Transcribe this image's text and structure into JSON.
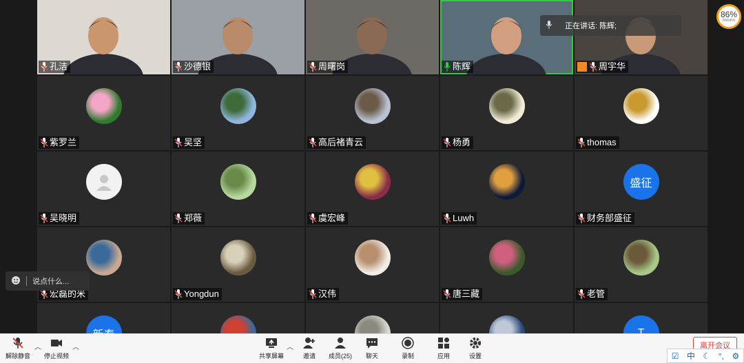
{
  "speaker": {
    "label": "正在讲话:",
    "name": "陈辉;"
  },
  "badge": {
    "percent": "86%",
    "sub": "PAKIKN"
  },
  "participants": [
    {
      "name": "孔洁",
      "kind": "video",
      "skin": "#c9966e",
      "bg": "#ddd8d2"
    },
    {
      "name": "沙德银",
      "kind": "video",
      "skin": "#b98b6a",
      "bg": "#9aa0a6"
    },
    {
      "name": "周曙岗",
      "kind": "video",
      "skin": "#8a6a54",
      "bg": "#6d6a66"
    },
    {
      "name": "陈辉",
      "kind": "video",
      "skin": "#d2a080",
      "bg": "#5a6e7a",
      "active": true
    },
    {
      "name": "周宇华",
      "kind": "video",
      "skin": "#c99a7a",
      "bg": "#4a4440",
      "orange": true
    },
    {
      "name": "紫罗兰",
      "kind": "img",
      "c1": "#2f7a2c",
      "c2": "#f4a6c6"
    },
    {
      "name": "吴坚",
      "kind": "img",
      "c1": "#8fb7de",
      "c2": "#3f6a3a"
    },
    {
      "name": "高后褚青云",
      "kind": "img",
      "c1": "#b9c3d4",
      "c2": "#6b5a48"
    },
    {
      "name": "杨勇",
      "kind": "img",
      "c1": "#f2ecd6",
      "c2": "#6a6a4a"
    },
    {
      "name": "thomas",
      "kind": "img",
      "c1": "#ffffff",
      "c2": "#c89a30"
    },
    {
      "name": "吴晓明",
      "kind": "default"
    },
    {
      "name": "郑薇",
      "kind": "img",
      "c1": "#b7d9a0",
      "c2": "#6a8a4a"
    },
    {
      "name": "虞宏峰",
      "kind": "img",
      "c1": "#8a2d4a",
      "c2": "#e0c040"
    },
    {
      "name": "Luwh",
      "kind": "img",
      "c1": "#0e1a3a",
      "c2": "#e0a040"
    },
    {
      "name": "财务部盛征",
      "kind": "text",
      "text": "盛征",
      "color": "#1a73e8"
    },
    {
      "name": "宏磊的米",
      "kind": "img",
      "c1": "#c8a890",
      "c2": "#3a6a9a"
    },
    {
      "name": "Yongdun",
      "kind": "img",
      "c1": "#6a5a40",
      "c2": "#d8d0b8"
    },
    {
      "name": "汉伟",
      "kind": "img",
      "c1": "#f0ece6",
      "c2": "#b89070"
    },
    {
      "name": "唐三藏",
      "kind": "img",
      "c1": "#3a5a2a",
      "c2": "#d06080"
    },
    {
      "name": "老管",
      "kind": "img",
      "c1": "#a8c888",
      "c2": "#6a5a3a"
    },
    {
      "name": "",
      "kind": "text",
      "text": "新春",
      "color": "#1a73e8"
    },
    {
      "name": "",
      "kind": "img",
      "c1": "#3a6a9a",
      "c2": "#d04030"
    },
    {
      "name": "",
      "kind": "img",
      "c1": "#d8d8d0",
      "c2": "#8a8a80"
    },
    {
      "name": "",
      "kind": "img",
      "c1": "#2a4a7a",
      "c2": "#c0c8d8"
    },
    {
      "name": "",
      "kind": "text",
      "text": "T",
      "color": "#1a73e8"
    }
  ],
  "chat_popup": {
    "text": "说点什么..."
  },
  "toolbar": {
    "unmute": "解除静音",
    "stop_video": "停止视频",
    "share": "共享屏幕",
    "invite": "邀请",
    "members": "成员(25)",
    "chat": "聊天",
    "record": "录制",
    "apps": "应用",
    "settings": "设置",
    "leave": "离开会议"
  },
  "tray": {
    "ime": "中"
  }
}
